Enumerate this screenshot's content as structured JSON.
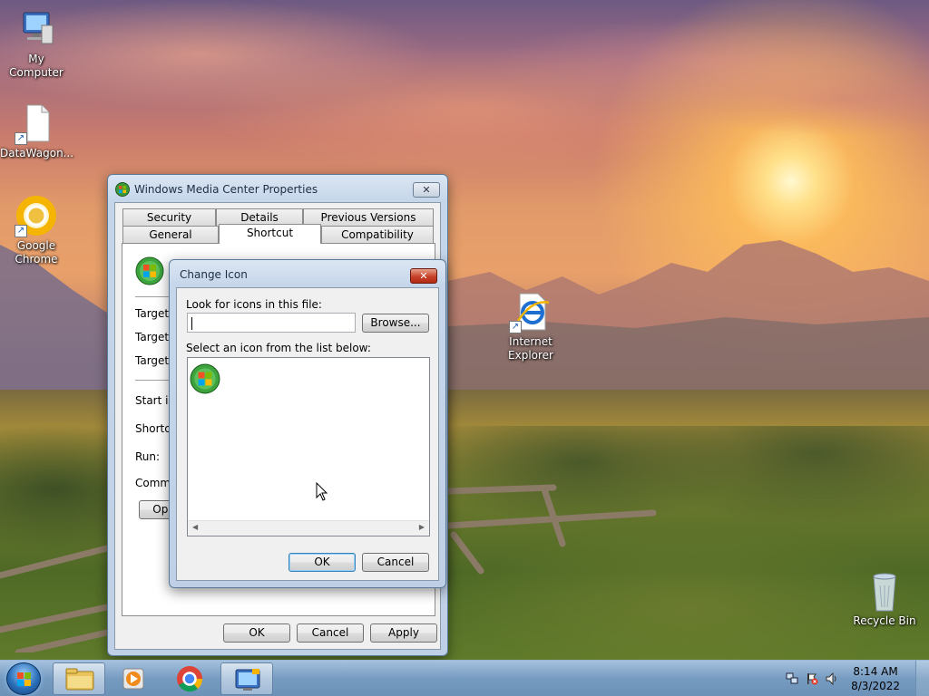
{
  "desktop": {
    "icons": [
      {
        "label": "My Computer"
      },
      {
        "label": "DataWagon..."
      },
      {
        "label": "Google\nChrome"
      },
      {
        "label": "Internet\nExplorer"
      },
      {
        "label": "Recycle Bin"
      }
    ]
  },
  "properties_window": {
    "title": "Windows Media Center Properties",
    "tabs_row1": [
      "Security",
      "Details",
      "Previous Versions"
    ],
    "tabs_row2": [
      "General",
      "Shortcut",
      "Compatibility"
    ],
    "active_tab": "Shortcut",
    "fields": {
      "target_type": "Target ty",
      "target_location": "Target lo",
      "target": "Target:",
      "start_in": "Start in:",
      "shortcut_key": "Shortcut",
      "run": "Run:",
      "comment": "Commen",
      "open_button": "Oper"
    },
    "buttons": {
      "ok": "OK",
      "cancel": "Cancel",
      "apply": "Apply"
    }
  },
  "change_icon_dialog": {
    "title": "Change Icon",
    "look_label": "Look for icons in this file:",
    "file_value": "",
    "browse_button": "Browse...",
    "select_label": "Select an icon from the list below:",
    "icons": [
      "windows-media-center-icon"
    ],
    "ok_button": "OK",
    "cancel_button": "Cancel"
  },
  "taskbar": {
    "clock_time": "8:14 AM",
    "clock_date": "8/3/2022"
  }
}
